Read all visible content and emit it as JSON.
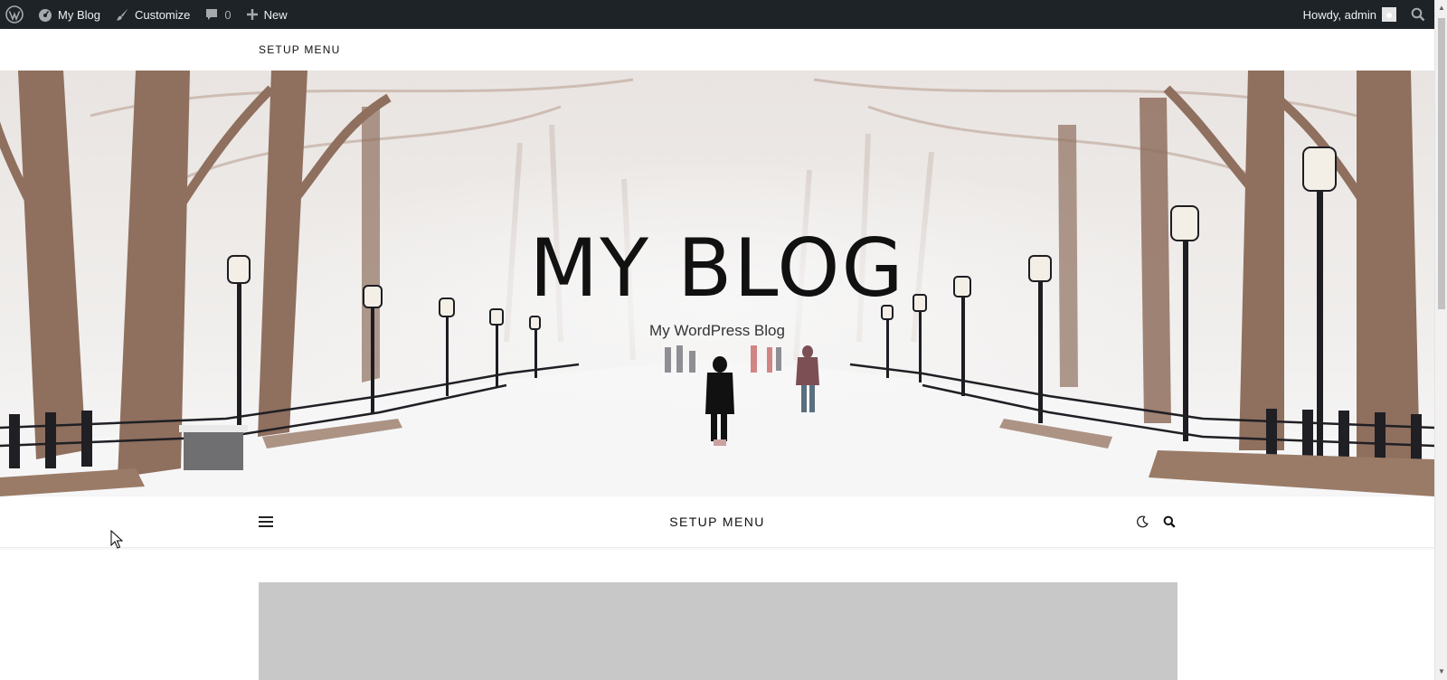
{
  "admin_bar": {
    "wp_logo_icon": "wordpress-icon",
    "site_name": "My Blog",
    "customize_label": "Customize",
    "comments_count": "0",
    "new_label": "New",
    "howdy_label": "Howdy, admin"
  },
  "top_menu": {
    "label": "SETUP MENU"
  },
  "hero": {
    "site_title": "MY BLOG",
    "tagline": "My WordPress Blog"
  },
  "main_nav": {
    "label": "SETUP MENU",
    "icons": [
      "hamburger-menu-icon",
      "dark-mode-moon-icon",
      "search-icon"
    ]
  },
  "colors": {
    "admin_bar_bg": "#1d2327",
    "admin_bar_text": "#f0f0f1",
    "featured_placeholder": "#c8c8c8"
  }
}
